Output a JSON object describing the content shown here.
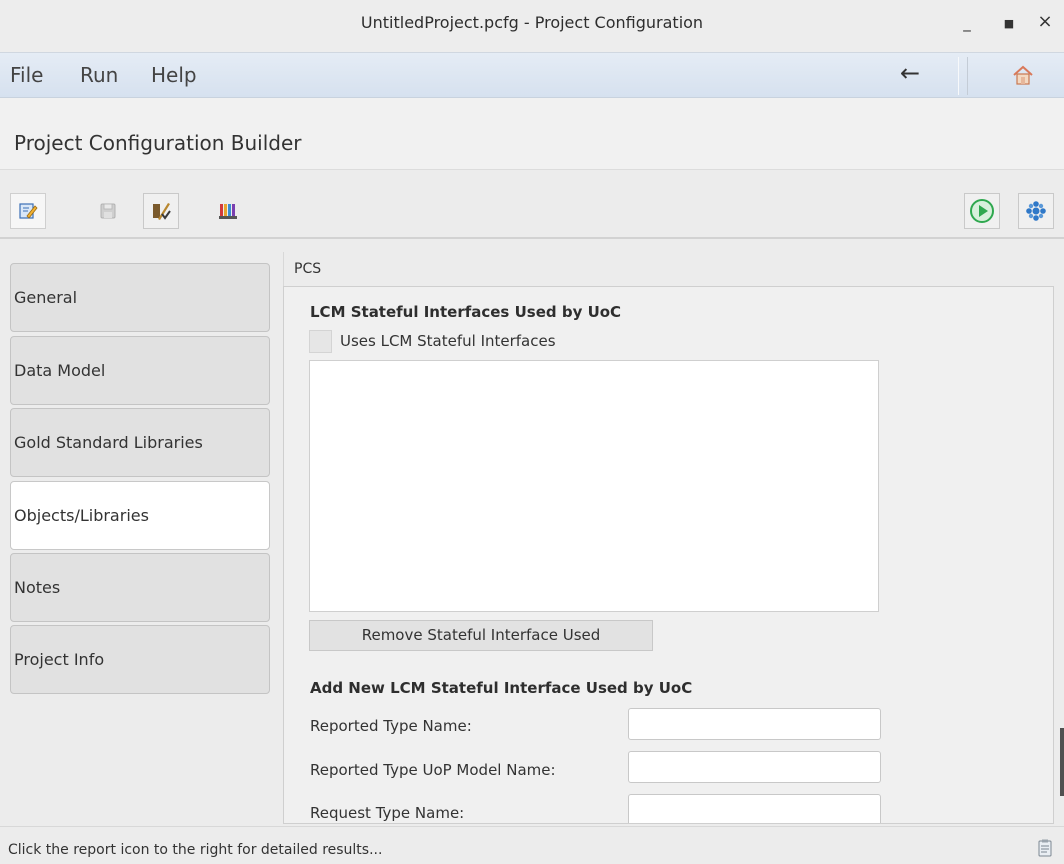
{
  "window": {
    "title": "UntitledProject.pcfg - Project Configuration",
    "minimize_glyph": "_",
    "maximize_glyph": "■",
    "close_glyph": "×"
  },
  "menubar": {
    "items": [
      "File",
      "Run",
      "Help"
    ],
    "back_glyph": "←",
    "home_icon": "home-icon"
  },
  "builder": {
    "title": "Project Configuration Builder"
  },
  "toolbar": {
    "left_buttons": [
      "edit-icon",
      "save-icon",
      "validate-icon",
      "report-colors-icon"
    ],
    "right_buttons": [
      "run-icon",
      "settings-icon"
    ]
  },
  "tabs": [
    {
      "label": "General",
      "selected": false
    },
    {
      "label": "Data Model",
      "selected": false
    },
    {
      "label": "Gold Standard Libraries",
      "selected": false
    },
    {
      "label": "Objects/Libraries",
      "selected": true
    },
    {
      "label": "Notes",
      "selected": false
    },
    {
      "label": "Project Info",
      "selected": false
    }
  ],
  "content": {
    "header": "PCS",
    "section1_title": "LCM Stateful Interfaces Used by UoC",
    "checkbox_label": "Uses LCM Stateful Interfaces",
    "checkbox_checked": false,
    "remove_button": "Remove Stateful Interface Used",
    "section2_title": "Add New LCM Stateful Interface Used by UoC",
    "fields": [
      {
        "label": "Reported Type Name:",
        "value": ""
      },
      {
        "label": "Reported Type UoP Model Name:",
        "value": ""
      },
      {
        "label": "Request Type Name:",
        "value": ""
      }
    ]
  },
  "status": {
    "text": "Click the report icon to the right for detailed results..."
  },
  "colors": {
    "menubar_top": "#e5ecf5",
    "menubar_bottom": "#d6e1ef",
    "run_green": "#2fa84f",
    "settings_blue": "#2f78c8"
  }
}
